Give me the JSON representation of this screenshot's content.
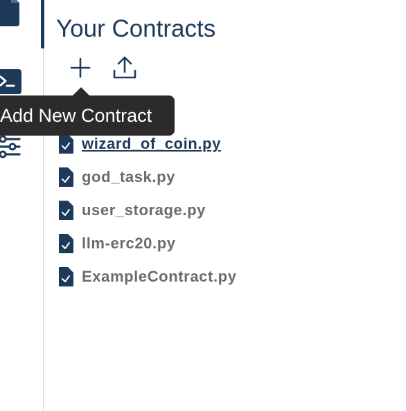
{
  "header": {
    "title": "Your Contracts"
  },
  "toolbar": {
    "add_icon": "plus-icon",
    "upload_icon": "upload-icon"
  },
  "tooltip": {
    "text": "Add New Contract"
  },
  "sidebar": {
    "items": [
      {
        "icon": "file-icon",
        "active": true
      },
      {
        "icon": "terminal-icon",
        "active": false
      },
      {
        "icon": "settings-sliders-icon",
        "active": false
      }
    ]
  },
  "contracts": {
    "files": [
      {
        "name": "wizard_of_coin.py",
        "active": true
      },
      {
        "name": "god_task.py",
        "active": false
      },
      {
        "name": "user_storage.py",
        "active": false
      },
      {
        "name": "llm-erc20.py",
        "active": false
      },
      {
        "name": "ExampleContract.py",
        "active": false
      }
    ]
  },
  "colors": {
    "primary": "#1e3a5a",
    "file_text": "#6b6b6b",
    "tooltip_bg": "#2b2b2b",
    "divider": "#c9d3e0"
  }
}
